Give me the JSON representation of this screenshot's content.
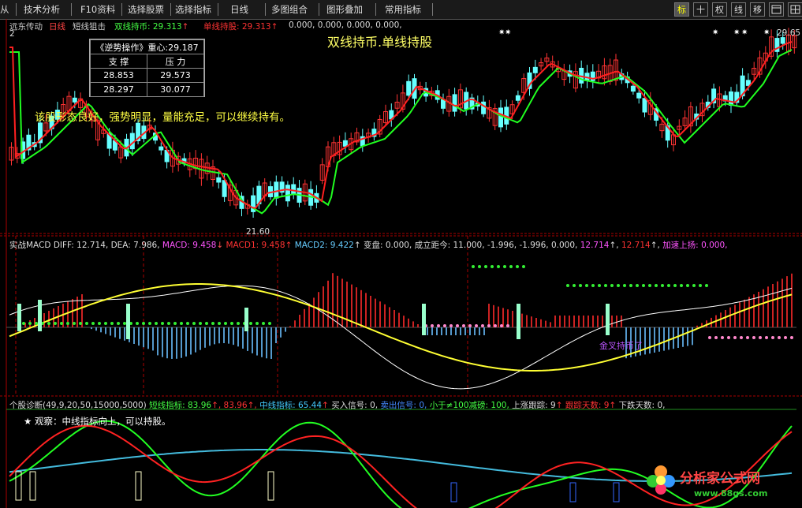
{
  "toolbar": {
    "items": [
      "从",
      "技术分析",
      "F10资料",
      "选择股票",
      "选择指标",
      "日线",
      "多图组合",
      "图形叠加",
      "常用指标"
    ],
    "right_buttons": [
      "标",
      "十",
      "权",
      "线",
      "移"
    ]
  },
  "main_panel": {
    "stock": "远东传动",
    "period": "日线",
    "indicator": "短线狙击",
    "line1_label": "双线持币: 29.313",
    "line2_label": "单线持股: 29.313",
    "zeros": "0.000, 0.000, 0.000, 0.000,",
    "title_text": "双线持币.单线持股",
    "comment": "该股形态良好，强势明显，量能充足，可以继续持有。",
    "high_price": "29.65",
    "low_price": "21.60",
    "side_num": "2",
    "box": {
      "title": "《逆势操作》重心:29.187",
      "headers": [
        "支 撑",
        "压 力"
      ],
      "rows": [
        [
          "28.853",
          "29.573"
        ],
        [
          "28.297",
          "30.077"
        ]
      ]
    }
  },
  "macd_panel": {
    "name": "实战MACD",
    "diff": "DIFF: 12.714",
    "dea": "DEA: 7.986",
    "macd": "MACD: 9.458",
    "macd1": "MACD1: 9.458",
    "macd2": "MACD2: 9.422",
    "biandou": "变盘: 0.000,",
    "chengli": "成立距今: 11.000,",
    "vals": "-1.996, -1.996, 0.000,",
    "v12a": "12.714",
    "v12b": "12.714",
    "jiasu": "加速上扬: 0.000,",
    "mark_text": "金叉持币了"
  },
  "diag_panel": {
    "name": "个股诊断",
    "params": "(49,9,20,50,15000,5000)",
    "short": "短线指标: 83.96",
    "short2": "83.96",
    "mid": "中线指标: 65.44",
    "buy": "买入信号: 0,",
    "sell": "卖出信号: 0,",
    "less": "小于≠100减磅: 100,",
    "track": "上涨跟踪: 9",
    "trackd": "跟踪天数: 9",
    "down": "下跌天数: 0,",
    "observe": "★ 观察：中线指标向上，可以持股。"
  },
  "watermark": {
    "brand": "分析家公式网",
    "url": "www.88gs.com"
  },
  "colors": {
    "bg": "#000000",
    "up": "#ff2222",
    "down": "#66ffff",
    "ma_red": "#ff2020",
    "ma_green": "#20ff20",
    "yellow": "#ffff00",
    "white": "#ffffff"
  }
}
